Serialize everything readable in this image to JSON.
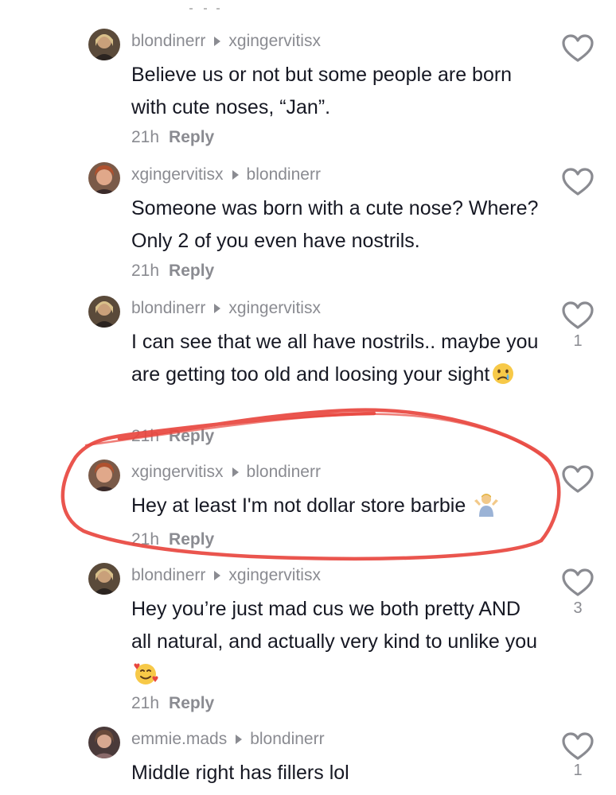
{
  "comments": [
    {
      "author": "blondinerr",
      "reply_to": "xgingervitisx",
      "text": "Believe us or not but some people are born with cute noses, “Jan”.",
      "emoji": "",
      "time": "21h",
      "reply_label": "Reply",
      "likes": ""
    },
    {
      "author": "xgingervitisx",
      "reply_to": "blondinerr",
      "text": "Someone was born with a cute nose? Where? Only 2 of you even have nostrils.",
      "emoji": "",
      "time": "21h",
      "reply_label": "Reply",
      "likes": ""
    },
    {
      "author": "blondinerr",
      "reply_to": "xgingervitisx",
      "text": "I can see that we all have nostrils.. maybe you are getting too old and loosing your sight",
      "emoji": "crying-face",
      "time": "21h",
      "reply_label": "Reply",
      "likes": "1"
    },
    {
      "author": "xgingervitisx",
      "reply_to": "blondinerr",
      "text": "Hey at least I'm not dollar store barbie",
      "emoji": "person-shrugging",
      "time": "21h",
      "reply_label": "Reply",
      "likes": ""
    },
    {
      "author": "blondinerr",
      "reply_to": "xgingervitisx",
      "text": "Hey you’re just mad cus we both pretty AND all natural, and actually very kind to unlike you",
      "emoji": "smiling-face-with-hearts",
      "time": "21h",
      "reply_label": "Reply",
      "likes": "3"
    },
    {
      "author": "emmie.mads",
      "reply_to": "blondinerr",
      "text": "Middle right has fillers lol",
      "emoji": "",
      "time": "",
      "reply_label": "",
      "likes": "1"
    }
  ],
  "colors": {
    "text": "#161823",
    "muted": "#8a8b91",
    "highlight": "#e8473f"
  },
  "icons": {
    "like": "heart-outline-icon",
    "arrow": "reply-arrow-icon"
  }
}
